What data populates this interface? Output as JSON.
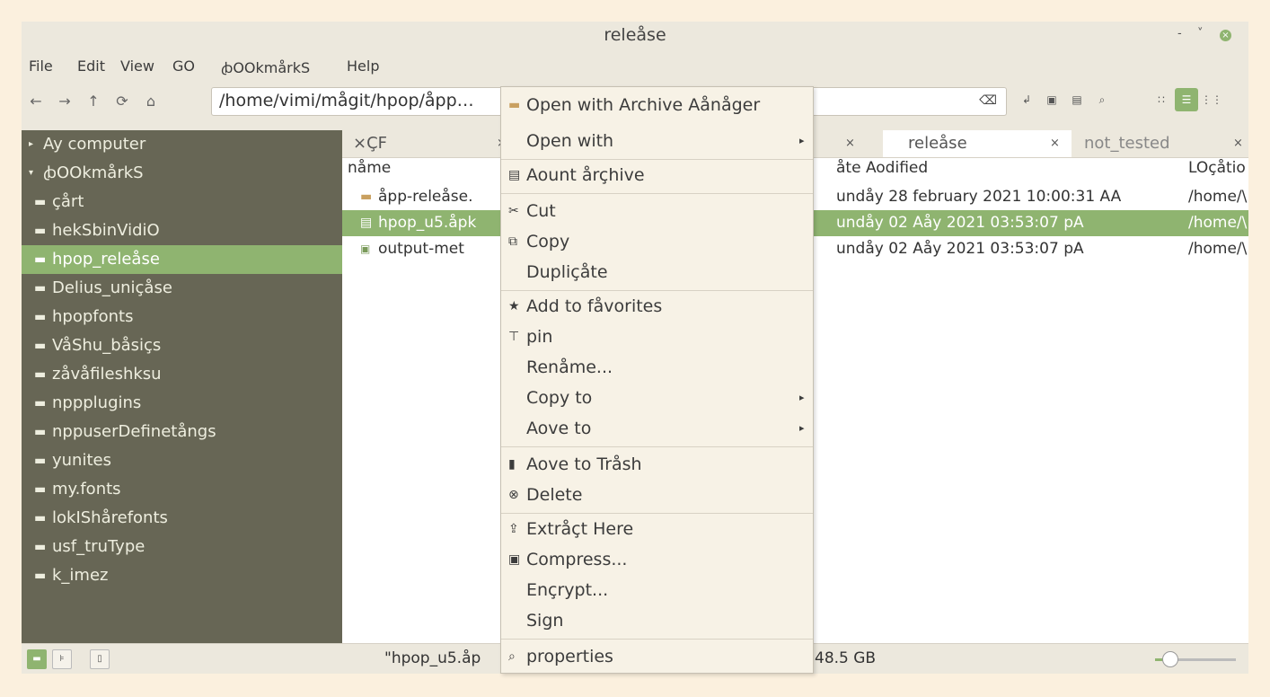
{
  "window": {
    "title": "releåse",
    "controls": [
      "-",
      "˅",
      "×"
    ]
  },
  "menubar": [
    "File",
    "Edit",
    "View",
    "GO",
    "ꞗOOkmårkS",
    "Help"
  ],
  "toolbar": {
    "path": "/home/vimi/mågit/hpop/åpp…",
    "icons": [
      "back-icon",
      "forward-icon",
      "up-icon",
      "reload-icon",
      "home-icon"
    ]
  },
  "sidebar": {
    "items": [
      {
        "label": "Ay computer",
        "kind": "header-collapsed"
      },
      {
        "label": "ꞗOOkmårkS",
        "kind": "header-expanded"
      },
      {
        "label": "çårt",
        "kind": "folder"
      },
      {
        "label": "hekSbinVidiO",
        "kind": "folder-special"
      },
      {
        "label": "hpop_releåse",
        "kind": "folder",
        "selected": true
      },
      {
        "label": "Delius_uniçåse",
        "kind": "folder-special"
      },
      {
        "label": "hpopfonts",
        "kind": "folder"
      },
      {
        "label": "VåShu_båsiçs",
        "kind": "folder-special"
      },
      {
        "label": "zåvåfileshksu",
        "kind": "folder"
      },
      {
        "label": "nppplugins",
        "kind": "folder"
      },
      {
        "label": "nppuserDefinetångs",
        "kind": "folder"
      },
      {
        "label": "yunites",
        "kind": "folder"
      },
      {
        "label": "my.fonts",
        "kind": "folder"
      },
      {
        "label": "lokIShårefonts",
        "kind": "folder"
      },
      {
        "label": "usf_truType",
        "kind": "folder"
      },
      {
        "label": "k_imez",
        "kind": "folder"
      }
    ]
  },
  "tabs": [
    {
      "label": "×ÇF",
      "close": "×"
    },
    {
      "label": "releåse",
      "close": "×",
      "active": true
    },
    {
      "label": "not_tested",
      "close": "×"
    }
  ],
  "columns": {
    "name": "nåme",
    "date": "åte Aodified",
    "location": "LOçåtio"
  },
  "files": [
    {
      "name": "åpp-releåse.",
      "date": "undåy 28 february 2021 10:00:31 AA",
      "location": "/home/\\",
      "icon": "folder"
    },
    {
      "name": "hpop_u5.åpk",
      "date": "undåy 02 Aåy 2021 03:53:07 pA",
      "location": "/home/\\",
      "icon": "file",
      "selected": true
    },
    {
      "name": "output-met",
      "date": "undåy 02 Aåy 2021 03:53:07 pA",
      "location": "/home/\\",
      "icon": "json"
    }
  ],
  "status": {
    "text": "\"hpop_u5.åp",
    "size": "48.5 GB"
  },
  "context_menu": [
    {
      "label": "Open with Archive Aånåger",
      "icon": "archive-icon"
    },
    {
      "label": "Open with",
      "submenu": true
    },
    {
      "sep": true
    },
    {
      "label": "Aount årçhive",
      "icon": "mount-icon"
    },
    {
      "sep": true
    },
    {
      "label": "Cut",
      "icon": "cut-icon"
    },
    {
      "label": "Copy",
      "icon": "copy-icon"
    },
    {
      "label": "Dupliçåte"
    },
    {
      "sep": true
    },
    {
      "label": "Add to fåvorites",
      "icon": "star-icon"
    },
    {
      "label": "pin",
      "icon": "pin-icon"
    },
    {
      "label": "Renåme..."
    },
    {
      "label": "Copy to",
      "submenu": true
    },
    {
      "label": "Aove to",
      "submenu": true
    },
    {
      "sep": true
    },
    {
      "label": "Aove to Tråsh",
      "icon": "trash-icon"
    },
    {
      "label": "Delete",
      "icon": "delete-icon"
    },
    {
      "sep": true
    },
    {
      "label": "Extråçt Here",
      "icon": "extract-icon"
    },
    {
      "label": "Compress...",
      "icon": "compress-icon"
    },
    {
      "label": "Ençrypt..."
    },
    {
      "label": "Sign"
    },
    {
      "sep": true
    },
    {
      "label": "properties",
      "icon": "properties-icon"
    }
  ],
  "colors": {
    "accent": "#8fb470",
    "sidebar": "#676655",
    "background": "#fbf0de"
  }
}
